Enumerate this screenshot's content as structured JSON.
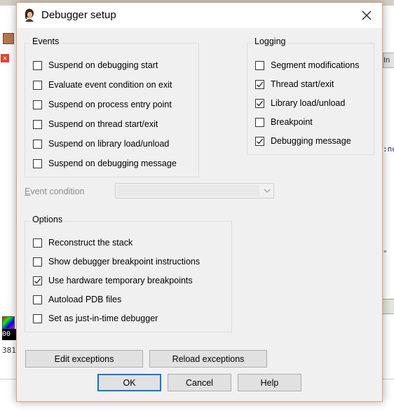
{
  "dialog": {
    "title": "Debugger setup",
    "close_glyph": "✕"
  },
  "events": {
    "legend": "Events",
    "items": [
      {
        "label": "Suspend on debugging start",
        "checked": false
      },
      {
        "label": "Evaluate event condition on exit",
        "checked": false
      },
      {
        "label": "Suspend on process entry point",
        "checked": false
      },
      {
        "label": "Suspend on thread start/exit",
        "checked": false
      },
      {
        "label": "Suspend on library load/unload",
        "checked": false
      },
      {
        "label": "Suspend on debugging message",
        "checked": false
      }
    ]
  },
  "logging": {
    "legend": "Logging",
    "items": [
      {
        "label": "Segment modifications",
        "checked": false
      },
      {
        "label": "Thread start/exit",
        "checked": true
      },
      {
        "label": "Library load/unload",
        "checked": true
      },
      {
        "label": "Breakpoint",
        "checked": false
      },
      {
        "label": "Debugging message",
        "checked": true
      }
    ]
  },
  "event_condition": {
    "label": "Event condition",
    "value": ""
  },
  "options": {
    "legend": "Options",
    "items": [
      {
        "label": "Reconstruct the stack",
        "checked": false
      },
      {
        "label": "Show debugger breakpoint instructions",
        "checked": false
      },
      {
        "label": "Use hardware temporary breakpoints",
        "checked": true
      },
      {
        "label": "Autoload PDB files",
        "checked": false
      },
      {
        "label": "Set as just-in-time debugger",
        "checked": false
      }
    ]
  },
  "buttons": {
    "edit_exceptions": "Edit exceptions",
    "reload_exceptions": "Reload exceptions",
    "ok": "OK",
    "cancel": "Cancel",
    "help": "Help"
  },
  "background": {
    "right_tab": "In",
    "right_code1": ":no",
    "right_code2": "\"",
    "left_black": "00",
    "left_num": "381"
  },
  "colors": {
    "dialog_border": "#e6a16b",
    "default_button_border": "#0078d7"
  }
}
